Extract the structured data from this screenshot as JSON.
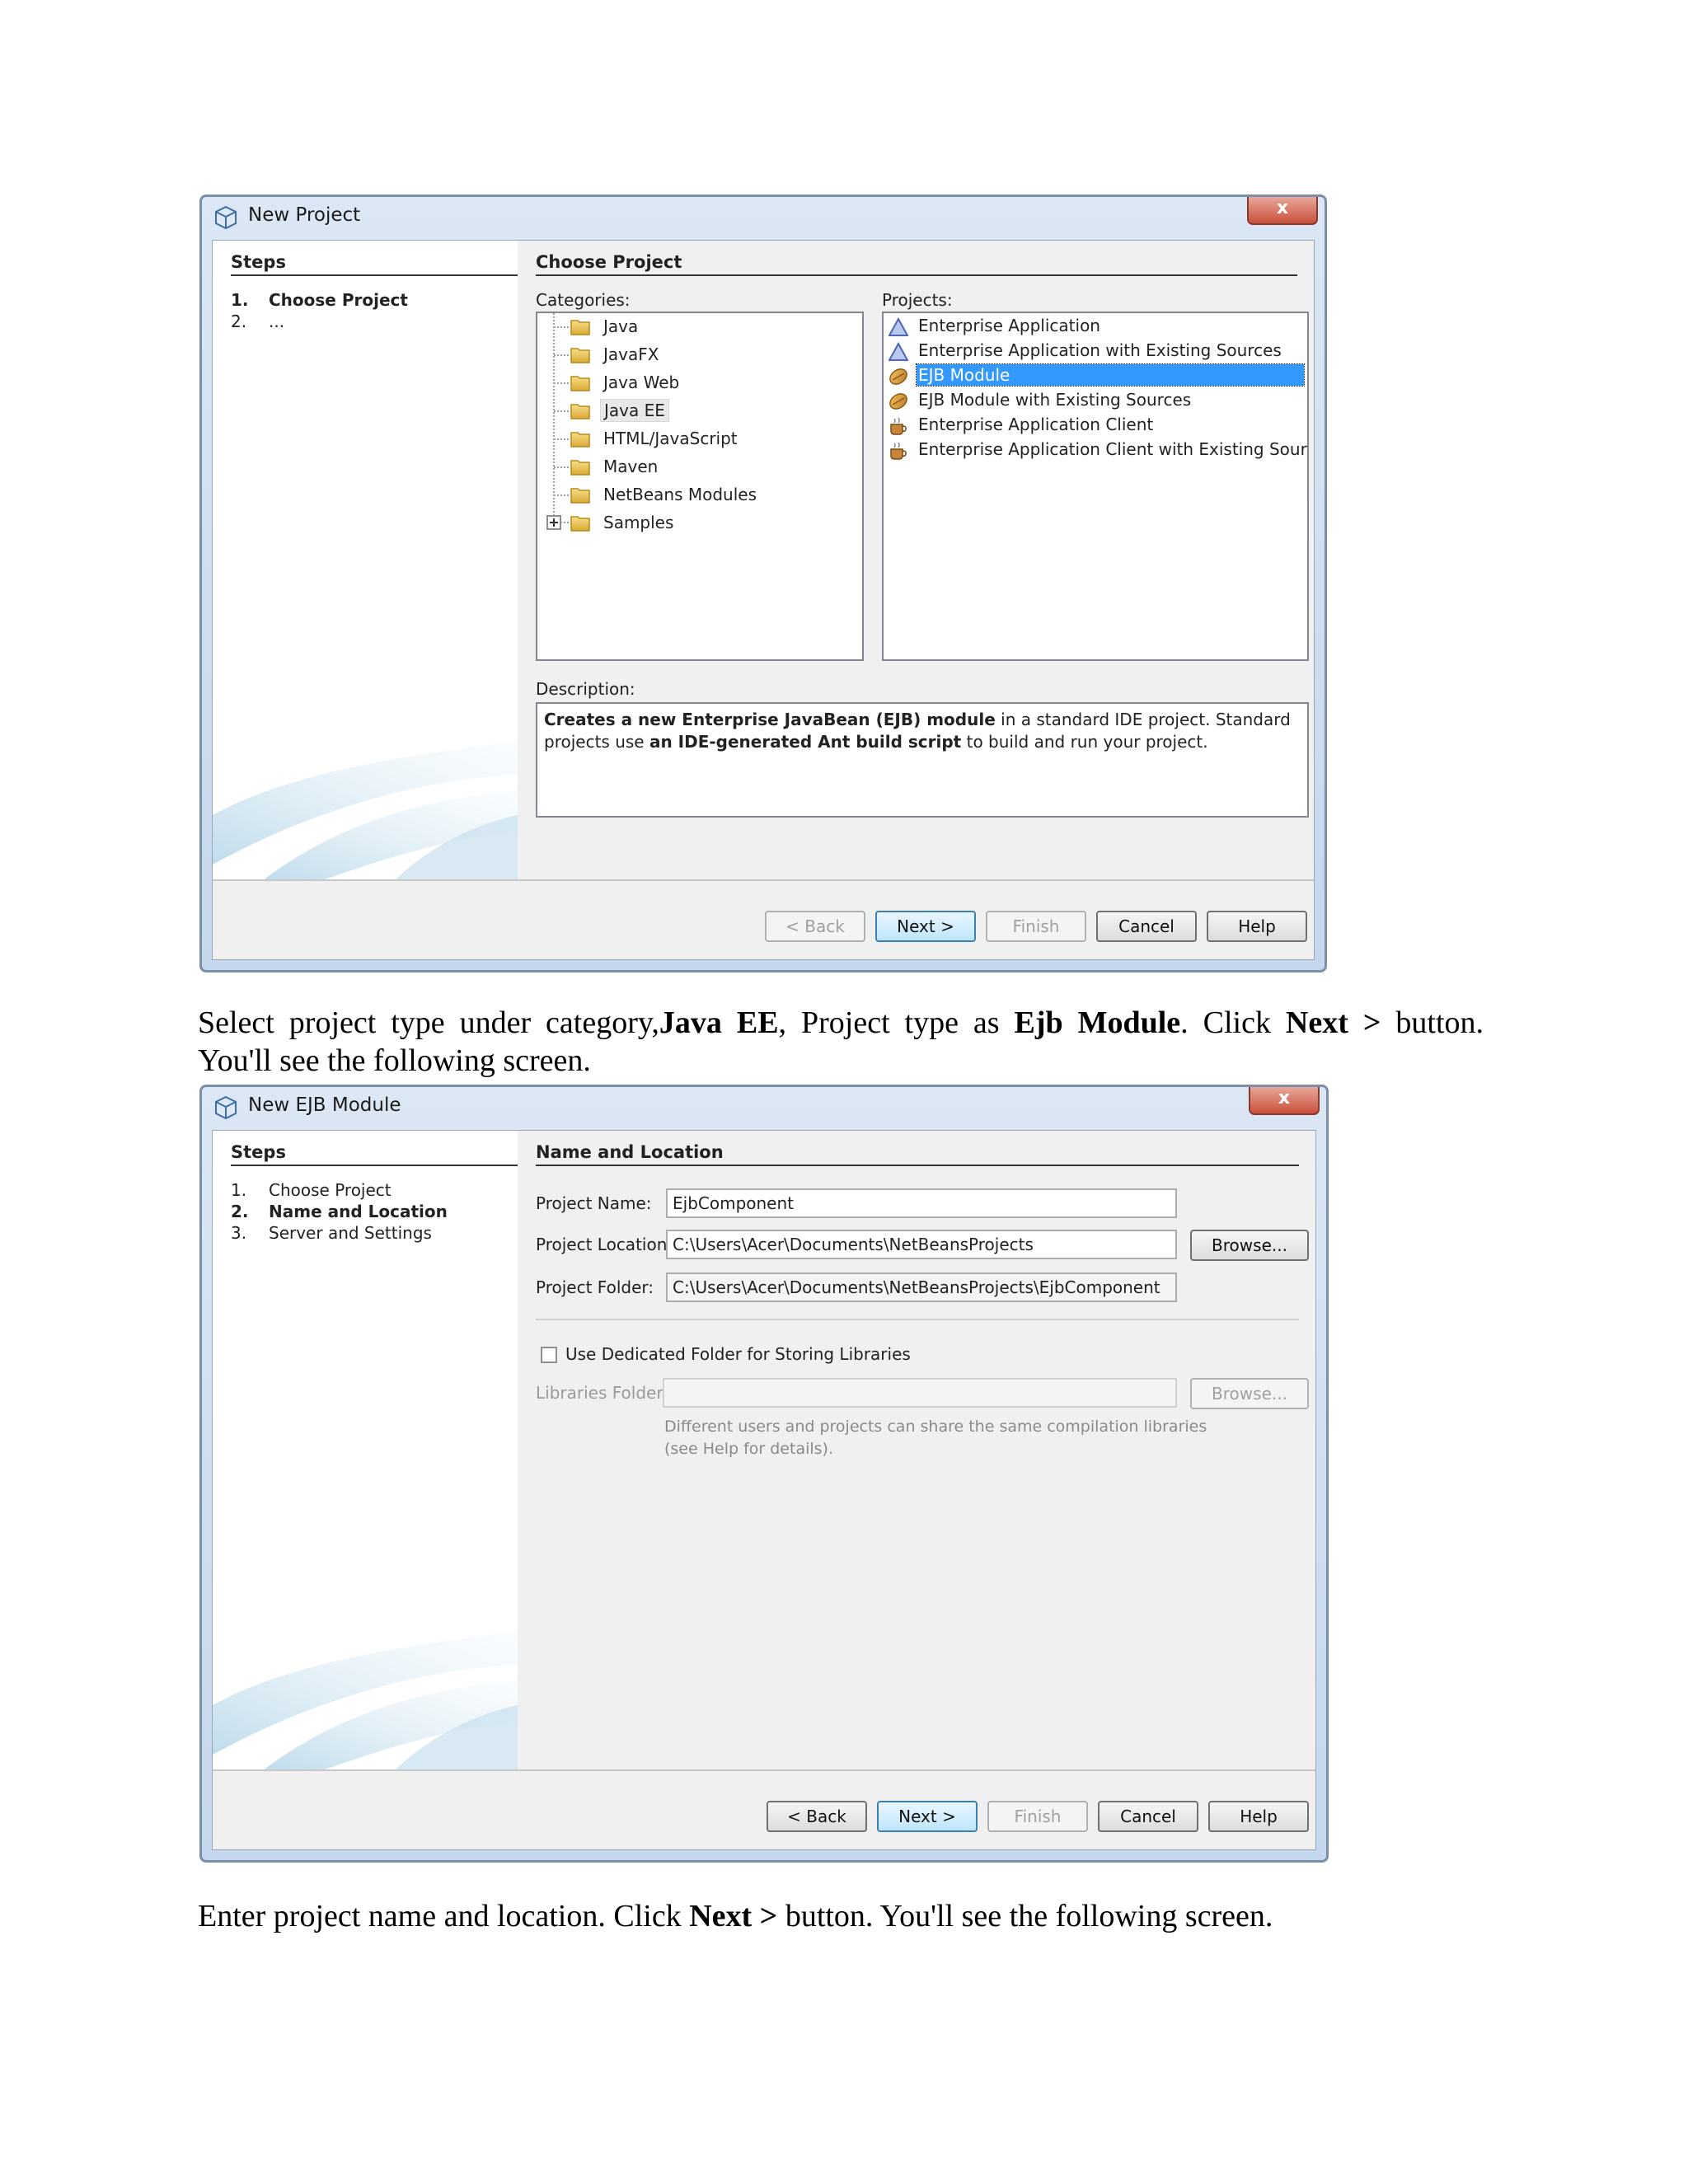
{
  "dialog1": {
    "title": "New Project",
    "close_label": "x",
    "steps_header": "Steps",
    "steps": [
      {
        "num": "1.",
        "label": "Choose Project"
      },
      {
        "num": "2.",
        "label": "..."
      }
    ],
    "panel_title": "Choose Project",
    "categories_label": "Categories:",
    "categories": [
      "Java",
      "JavaFX",
      "Java Web",
      "Java EE",
      "HTML/JavaScript",
      "Maven",
      "NetBeans Modules",
      "Samples"
    ],
    "projects_label": "Projects:",
    "projects": [
      "Enterprise Application",
      "Enterprise Application with Existing Sources",
      "EJB Module",
      "EJB Module with Existing Sources",
      "Enterprise Application Client",
      "Enterprise Application Client with Existing Sources"
    ],
    "description_label": "Description:",
    "description": {
      "b1": "Creates a new Enterprise JavaBean (EJB) module",
      "t1": " in a standard IDE project. Standard projects use ",
      "b2": "an IDE-generated Ant build script",
      "t2": " to build and run your project."
    },
    "buttons": {
      "back": "< Back",
      "next": "Next >",
      "finish": "Finish",
      "cancel": "Cancel",
      "help": "Help"
    }
  },
  "paragraph1": {
    "t1": "Select project type under category,",
    "b1": "Java EE",
    "t2": ", Project type as ",
    "b2": "Ejb Module",
    "t3": ". Click ",
    "b3": "Next >",
    "t4": " button.",
    "line2": "You'll see the following screen."
  },
  "dialog2": {
    "title": "New EJB Module",
    "close_label": "x",
    "steps_header": "Steps",
    "steps": [
      {
        "num": "1.",
        "label": "Choose Project"
      },
      {
        "num": "2.",
        "label": "Name and Location"
      },
      {
        "num": "3.",
        "label": "Server and Settings"
      }
    ],
    "panel_title": "Name and Location",
    "project_name_label": "Project Name:",
    "project_name": "EjbComponent",
    "project_location_label": "Project Location:",
    "project_location": "C:\\Users\\Acer\\Documents\\NetBeansProjects",
    "project_folder_label": "Project Folder:",
    "project_folder": "C:\\Users\\Acer\\Documents\\NetBeansProjects\\EjbComponent",
    "browse_label": "Browse...",
    "dedicated_folder_label": "Use Dedicated Folder for Storing Libraries",
    "libraries_folder_label": "Libraries Folder:",
    "libraries_folder": "",
    "hint_line1": "Different users and projects can share the same compilation libraries",
    "hint_line2": "(see Help for details).",
    "buttons": {
      "back": "< Back",
      "next": "Next >",
      "finish": "Finish",
      "cancel": "Cancel",
      "help": "Help"
    }
  },
  "paragraph2": {
    "t1": "Enter project name and location. Click ",
    "b1": "Next >",
    "t2": " button. You'll see the following screen."
  }
}
